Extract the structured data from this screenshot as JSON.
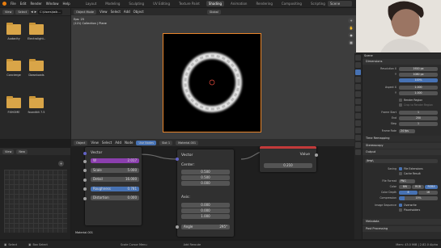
{
  "topbar": {
    "menus": [
      "File",
      "Edit",
      "Render",
      "Window",
      "Help"
    ],
    "workspaces": [
      "Layout",
      "Modeling",
      "Sculpting",
      "UV Editing",
      "Texture Paint",
      "Shading",
      "Animation",
      "Rendering",
      "Compositing",
      "Scripting"
    ],
    "active_workspace": "Shading",
    "scene": "Scene",
    "accent_color": "#e87d0d"
  },
  "file_browser": {
    "view_label": "View",
    "select_label": "Select",
    "path": "C:\\Users\\talk...",
    "folders": [
      "Audacity",
      "Electrolight...",
      "Concierge",
      "Downloads",
      "FXHOME",
      "foundkit 7.5"
    ]
  },
  "viewport": {
    "mode": "Object Mode",
    "menus": [
      "View",
      "Select",
      "Add",
      "Object"
    ],
    "shading": "Global",
    "info_line1": "Eps: 25",
    "info_line2": "(121) Collection | Plane"
  },
  "node_editor": {
    "type": "Object",
    "menus": [
      "View",
      "Select",
      "Add",
      "Node"
    ],
    "use_nodes": "Use Nodes",
    "slot": "Slot 1",
    "material": "Material.001",
    "footer_label": "Material.001",
    "noise_node": {
      "header": "Vector",
      "w_label": "W",
      "w_value": "2.017",
      "scale_label": "Scale",
      "scale_value": "5.000",
      "detail_label": "Detail",
      "detail_value": "16.000",
      "roughness_label": "Roughness",
      "roughness_value": "0.781",
      "distortion_label": "Distortion",
      "distortion_value": "0.000"
    },
    "rotate_node": {
      "header": "Vector",
      "center_label": "Center:",
      "center_values": [
        "0.500",
        "0.500",
        "0.000"
      ],
      "axis_label": "Axis:",
      "axis_values": [
        "0.000",
        "0.000",
        "1.000"
      ],
      "angle_label": "Angle",
      "angle_value": "295°"
    },
    "value_node": {
      "label": "Value",
      "value": "0.210"
    }
  },
  "left_panel": {
    "view_label": "View",
    "new_label": "New"
  },
  "properties": {
    "scene_label": "Scene",
    "dimensions": "Dimensions",
    "res_x_label": "Resolution X",
    "res_x": "1920 px",
    "res_y_label": "Y",
    "res_y": "1080 px",
    "res_pct": "100%",
    "aspect_x_label": "Aspect X",
    "aspect_x": "1.000",
    "aspect_y_label": "Y",
    "aspect_y": "1.000",
    "render_region": "Render Region",
    "crop_region": "Crop to Render Region",
    "frame_start_label": "Frame Start",
    "frame_start": "1",
    "end_label": "End",
    "end": "250",
    "step_label": "Step",
    "step": "1",
    "frame_rate_label": "Frame Rate",
    "frame_rate": "24 fps",
    "time_remapping": "Time Remapping",
    "stereoscopy": "Stereoscopy",
    "output": "Output",
    "output_path": "/tmp\\",
    "saving_label": "Saving",
    "file_extensions": "File Extensions",
    "cache_result": "Cache Result",
    "file_format_label": "File Format",
    "file_format": "PNG",
    "color_label": "Color",
    "color_options": [
      "BW",
      "RGB",
      "RGBA"
    ],
    "color_depth_label": "Color Depth",
    "color_depth": [
      "8",
      "16"
    ],
    "compression_label": "Compression",
    "compression": "15%",
    "image_seq_label": "Image Sequence",
    "overwrite": "Overwrite",
    "placeholders": "Placeholders",
    "metadata": "Metadata",
    "post_processing": "Post Processing"
  },
  "statusbar": {
    "select": "Select",
    "box_select": "Box Select",
    "scale": "Scale Cursor Menu",
    "add_reroute": "Add Reroute",
    "memory": "Mem: 43.0 MiB | 2.82.0 Alpha"
  }
}
